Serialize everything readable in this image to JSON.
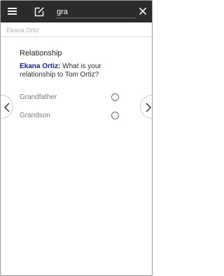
{
  "toolbar": {
    "menu_icon": "hamburger-menu-icon",
    "edit_icon": "edit-square-icon",
    "search_value": "gra",
    "clear_icon": "close-icon",
    "background": "#2b2b2b"
  },
  "subheader": {
    "text": "Ekana Ortiz"
  },
  "form": {
    "section_title": "Relationship",
    "question_name": "Ekana Ortiz:",
    "question_text": " What is your relationship to Tom Ortiz?",
    "options": [
      {
        "label": "Grandfather",
        "selected": false
      },
      {
        "label": "Grandson",
        "selected": false
      }
    ]
  },
  "navigation": {
    "prev_icon": "chevron-left-icon",
    "next_icon": "chevron-right-icon"
  },
  "colors": {
    "name_accent": "#15238f"
  }
}
